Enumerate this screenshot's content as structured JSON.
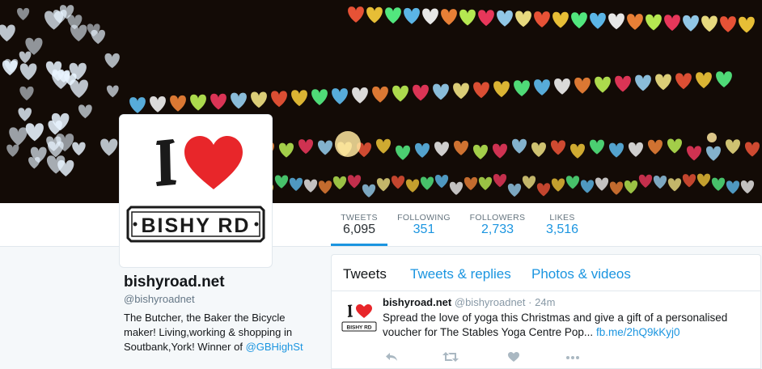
{
  "stats": [
    {
      "label": "TWEETS",
      "value": "6,095",
      "active": true
    },
    {
      "label": "FOLLOWING",
      "value": "351"
    },
    {
      "label": "FOLLOWERS",
      "value": "2,733"
    },
    {
      "label": "LIKES",
      "value": "3,516"
    }
  ],
  "avatar": {
    "logo_text": "BISHY RD"
  },
  "profile": {
    "name": "bishyroad.net",
    "handle": "@bishyroadnet",
    "bio_text": "The Butcher, the Baker the Bicycle maker! Living,working & shopping in Soutbank,York! Winner of ",
    "bio_link": "@GBHighSt"
  },
  "tabs": [
    {
      "label": "Tweets",
      "active": true
    },
    {
      "label": "Tweets & replies"
    },
    {
      "label": "Photos & videos"
    }
  ],
  "tweet": {
    "name": "bishyroad.net",
    "handle": "@bishyroadnet",
    "separator": "·",
    "time": "24m",
    "text": "Spread the love of yoga this Christmas and give a gift of a personalised voucher for  The Stables Yoga Centre Pop... ",
    "link": "fb.me/2hQ9kKyj0",
    "avatar_logo_text": "BISHY RD"
  },
  "icons": {
    "reply": "reply-icon",
    "retweet": "retweet-icon",
    "like": "heart-icon",
    "more": "more-icon"
  },
  "colors": {
    "link": "#1b95e0",
    "heart": "#e8262a"
  }
}
